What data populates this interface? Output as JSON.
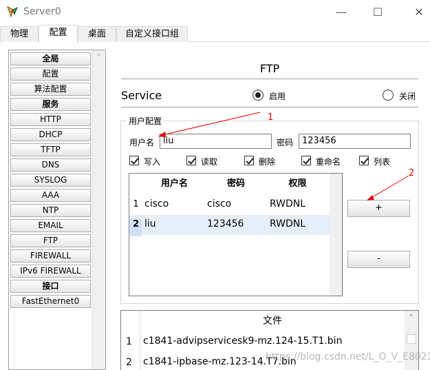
{
  "window": {
    "title": "Server0",
    "minimize_glyph": "—",
    "maximize_glyph": "☐",
    "close_glyph": "✕"
  },
  "tabs": [
    {
      "label": "物理",
      "active": false
    },
    {
      "label": "配置",
      "active": true
    },
    {
      "label": "桌面",
      "active": false
    },
    {
      "label": "自定义接口组",
      "active": false
    }
  ],
  "sidebar": {
    "items": [
      {
        "label": "全局",
        "section": true
      },
      {
        "label": "配置",
        "section": false
      },
      {
        "label": "算法配置",
        "section": false
      },
      {
        "label": "服务",
        "section": true
      },
      {
        "label": "HTTP",
        "section": false
      },
      {
        "label": "DHCP",
        "section": false
      },
      {
        "label": "TFTP",
        "section": false
      },
      {
        "label": "DNS",
        "section": false
      },
      {
        "label": "SYSLOG",
        "section": false
      },
      {
        "label": "AAA",
        "section": false
      },
      {
        "label": "NTP",
        "section": false
      },
      {
        "label": "EMAIL",
        "section": false
      },
      {
        "label": "FTP",
        "section": false
      },
      {
        "label": "FIREWALL",
        "section": false
      },
      {
        "label": "IPv6 FIREWALL",
        "section": false
      },
      {
        "label": "接口",
        "section": true
      },
      {
        "label": "FastEthernet0",
        "section": false
      }
    ],
    "scroll_up_glyph": "⌃"
  },
  "ftp": {
    "title": "FTP",
    "service_label": "Service",
    "on_label": "启用",
    "off_label": "关闭",
    "service_state": "on"
  },
  "user_config": {
    "group_title": "用户配置",
    "username_label": "用户名",
    "username_value": "liu",
    "password_label": "密码",
    "password_value": "123456",
    "permissions": [
      {
        "label": "写入",
        "checked": true
      },
      {
        "label": "读取",
        "checked": true
      },
      {
        "label": "删除",
        "checked": true
      },
      {
        "label": "重命名",
        "checked": true
      },
      {
        "label": "列表",
        "checked": true
      }
    ],
    "table": {
      "columns": [
        "用户名",
        "密码",
        "权限"
      ],
      "rows": [
        {
          "num": "1",
          "username": "cisco",
          "password": "cisco",
          "perm": "RWDNL"
        },
        {
          "num": "2",
          "username": "liu",
          "password": "123456",
          "perm": "RWDNL"
        }
      ]
    },
    "add_label": "+",
    "remove_label": "-"
  },
  "files": {
    "header": "文件",
    "rows": [
      {
        "num": "1",
        "name": "c1841-advipservicesk9-mz.124-15.T1.bin"
      },
      {
        "num": "2",
        "name": "c1841-ipbase-mz.123-14.T7.bin"
      }
    ]
  },
  "annotations": {
    "arrow1_label": "1",
    "arrow2_label": "2",
    "accent": "#e00000"
  },
  "watermark": "https://blog.csdn.net/L_O_V_E8023"
}
